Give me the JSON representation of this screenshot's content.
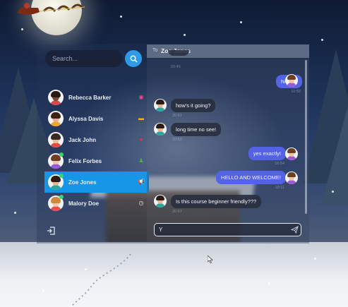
{
  "search": {
    "placeholder": "Search..."
  },
  "contacts": [
    {
      "name": "Rebecca Barker",
      "icon": "game-controller-icon",
      "online": false,
      "active": false,
      "skin": "#7a4e35",
      "hair": "#2b1a12",
      "body": "#e0464f"
    },
    {
      "name": "Alyssa Davis",
      "icon": "bus-icon",
      "online": false,
      "active": false,
      "skin": "#e2b08e",
      "hair": "#3a2418",
      "body": "#f0a52c"
    },
    {
      "name": "Jack John",
      "icon": "basketball-icon",
      "online": false,
      "active": false,
      "skin": "#e8be9c",
      "hair": "#3a2a22",
      "body": "#e94a3f"
    },
    {
      "name": "Felix Forbes",
      "icon": "gym-icon",
      "online": true,
      "active": false,
      "skin": "#f0c5a4",
      "hair": "#6b3f24",
      "body": "#9b59d8"
    },
    {
      "name": "Zoe Jones",
      "icon": "megaphone-icon",
      "online": true,
      "active": true,
      "skin": "#e8b392",
      "hair": "#2a1c15",
      "body": "#2aa7a0"
    },
    {
      "name": "Malory Doe",
      "icon": "clock-icon",
      "online": true,
      "active": false,
      "skin": "#f1c7a8",
      "hair": "#c98a3a",
      "body": "#e94f4f"
    }
  ],
  "chat": {
    "to_label": "To",
    "recipient": "Zoe Jones",
    "messages": [
      {
        "side": "sent",
        "text": "hi Zoe!",
        "time": "15:58"
      },
      {
        "side": "recv",
        "text": "how's it going?",
        "time": "20:51"
      },
      {
        "side": "recv",
        "text": "long time no see!",
        "time": "20:52"
      },
      {
        "side": "sent",
        "text": "yes exactly!",
        "time": "16:54"
      },
      {
        "side": "sent",
        "text": "HELLO AND WELCOME!",
        "time": "18:11"
      },
      {
        "side": "recv",
        "text": "Is this course beginner friendly???",
        "time": "20:57"
      }
    ],
    "top_time": "20:46",
    "composer_value": "Y"
  },
  "colors": {
    "accent": "#1596e6",
    "sent_bubble": "#5463e6",
    "search_button": "#2f9ae6"
  }
}
